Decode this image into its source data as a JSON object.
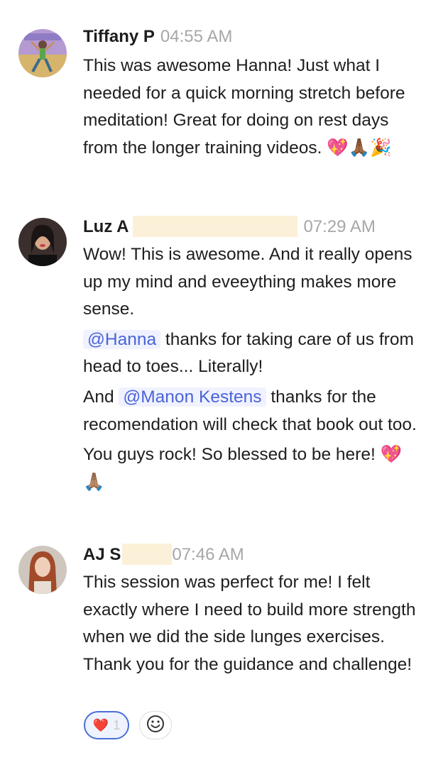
{
  "messages": [
    {
      "author": "Tiffany P",
      "time": "04:55 AM",
      "lines": [
        "This was awesome Hanna! Just what I needed for a quick morning stretch before meditation! Great for doing on rest days from the longer training videos. 💖🙏🏾🎉"
      ]
    },
    {
      "author": "Luz A",
      "time": "07:29 AM",
      "line1": "Wow! This is awesome. And it really opens up my mind and eveeything makes more sense.",
      "mention1": "@Hanna",
      "line2": " thanks for taking care of us from head to toes... Literally!",
      "line3_pre": "And ",
      "mention2": "@Manon Kestens",
      "line3": " thanks for the recomendation will check that book out too.",
      "line4": "You guys rock! So blessed to be here! 💖🙏🏽"
    },
    {
      "author": "AJ S",
      "time": "07:46 AM",
      "text": "This session was perfect for me! I felt exactly where I need to build more strength when we did the side lunges exercises. Thank you for the guidance and challenge!"
    }
  ],
  "reactions": [
    {
      "emoji": "❤️",
      "count": "1"
    }
  ],
  "add_reaction_icon": "smiley-icon"
}
